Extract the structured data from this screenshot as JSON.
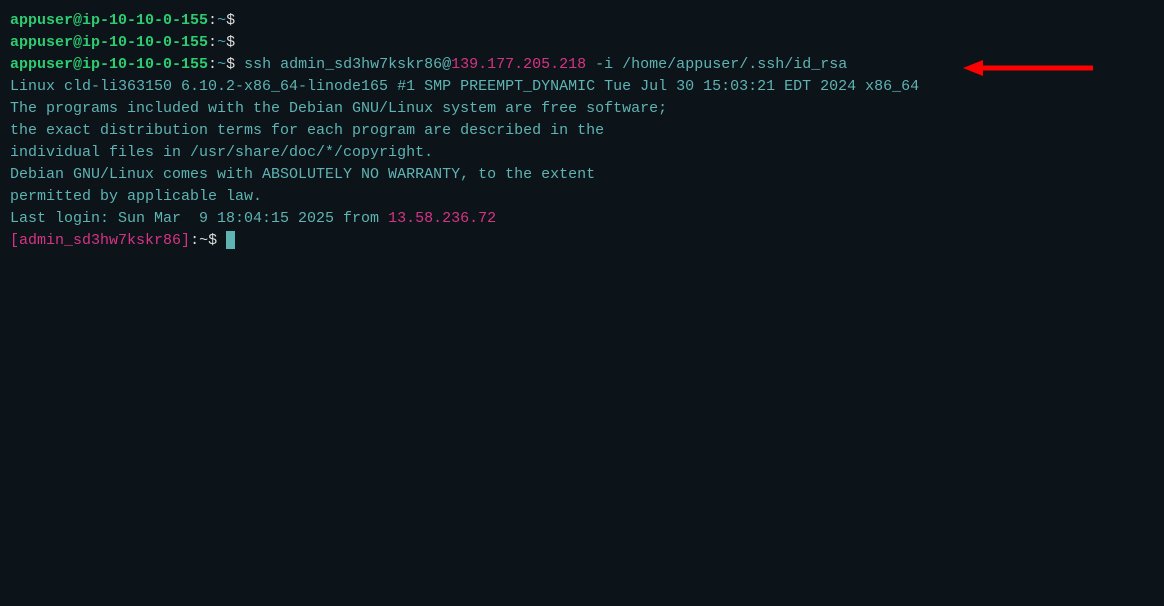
{
  "prompt1": {
    "user_host": "appuser@ip-10-10-0-155",
    "sep": ":",
    "path": "~",
    "dollar": "$"
  },
  "cmd_line": {
    "cmd": " ssh admin_sd3hw7kskr86@",
    "ip": "139.177.205.218",
    "args": " -i /home/appuser/.ssh/id_rsa"
  },
  "motd": {
    "l1": "Linux cld-li363150 6.10.2-x86_64-linode165 #1 SMP PREEMPT_DYNAMIC Tue Jul 30 15:03:21 EDT 2024 x86_64",
    "l2": "",
    "l3": "The programs included with the Debian GNU/Linux system are free software;",
    "l4": "the exact distribution terms for each program are described in the",
    "l5": "individual files in /usr/share/doc/*/copyright.",
    "l6": "",
    "l7": "Debian GNU/Linux comes with ABSOLUTELY NO WARRANTY, to the extent",
    "l8": "permitted by applicable law.",
    "last_login_pre": "Last login: Sun Mar  9 18:04:15 2025 from ",
    "last_login_ip": "13.58.236.72"
  },
  "prompt2": {
    "open": "[",
    "user": "admin_sd3hw7kskr86",
    "close": "]",
    "sep": ":",
    "path": "~",
    "dollar": "$ "
  },
  "arrow": {
    "color": "#ff0000"
  }
}
